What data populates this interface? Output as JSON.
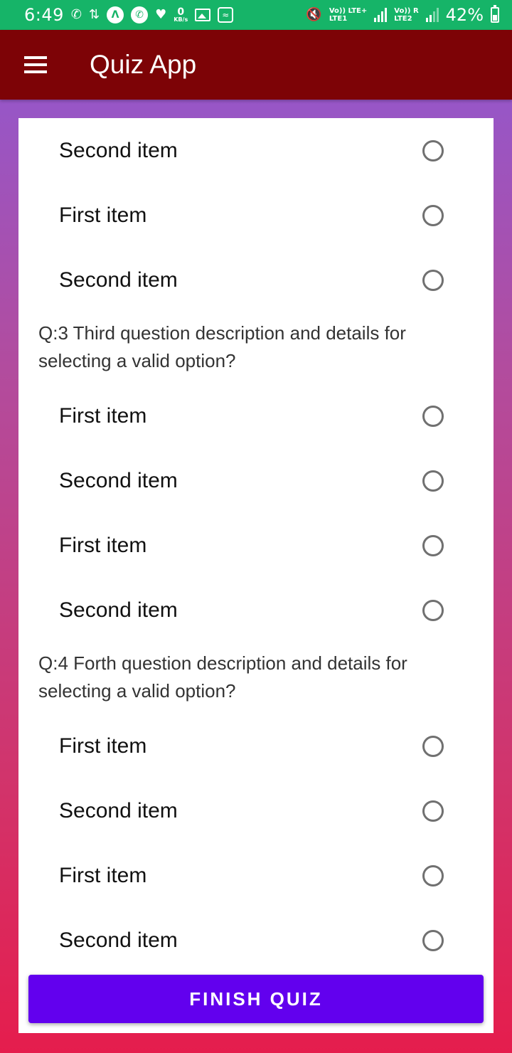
{
  "status_bar": {
    "time": "6:49",
    "network_speed_value": "0",
    "network_speed_unit": "KB/s",
    "lte1_label": "Vo)) LTE+",
    "lte1_sub": "LTE1",
    "lte2_label": "Vo)) R",
    "lte2_sub": "LTE2",
    "battery_percent": "42%",
    "battery_level": 0.42,
    "icons": [
      "call-icon",
      "download-icon",
      "app-icon",
      "whatsapp-icon",
      "health-icon",
      "gallery-icon",
      "wifi-hotspot-icon",
      "mute-icon"
    ]
  },
  "app_bar": {
    "title": "Quiz App",
    "menu_icon": "hamburger-menu-icon"
  },
  "quiz": {
    "q2_remaining_options": [
      "Second item",
      "First item",
      "Second item"
    ],
    "question3": {
      "text": "Q:3 Third question description and details for selecting a valid option?",
      "options": [
        "First item",
        "Second item",
        "First item",
        "Second item"
      ]
    },
    "question4": {
      "text": "Q:4 Forth question description and details for selecting a valid option?",
      "options": [
        "First item",
        "Second item",
        "First item",
        "Second item"
      ]
    }
  },
  "finish_button": {
    "label": "FINISH QUIZ"
  },
  "colors": {
    "status_bar": "#16b468",
    "app_bar": "#7d0306",
    "button": "#6200ee",
    "gradient_top": "#8d5ad6",
    "gradient_bottom": "#e51d4d"
  }
}
